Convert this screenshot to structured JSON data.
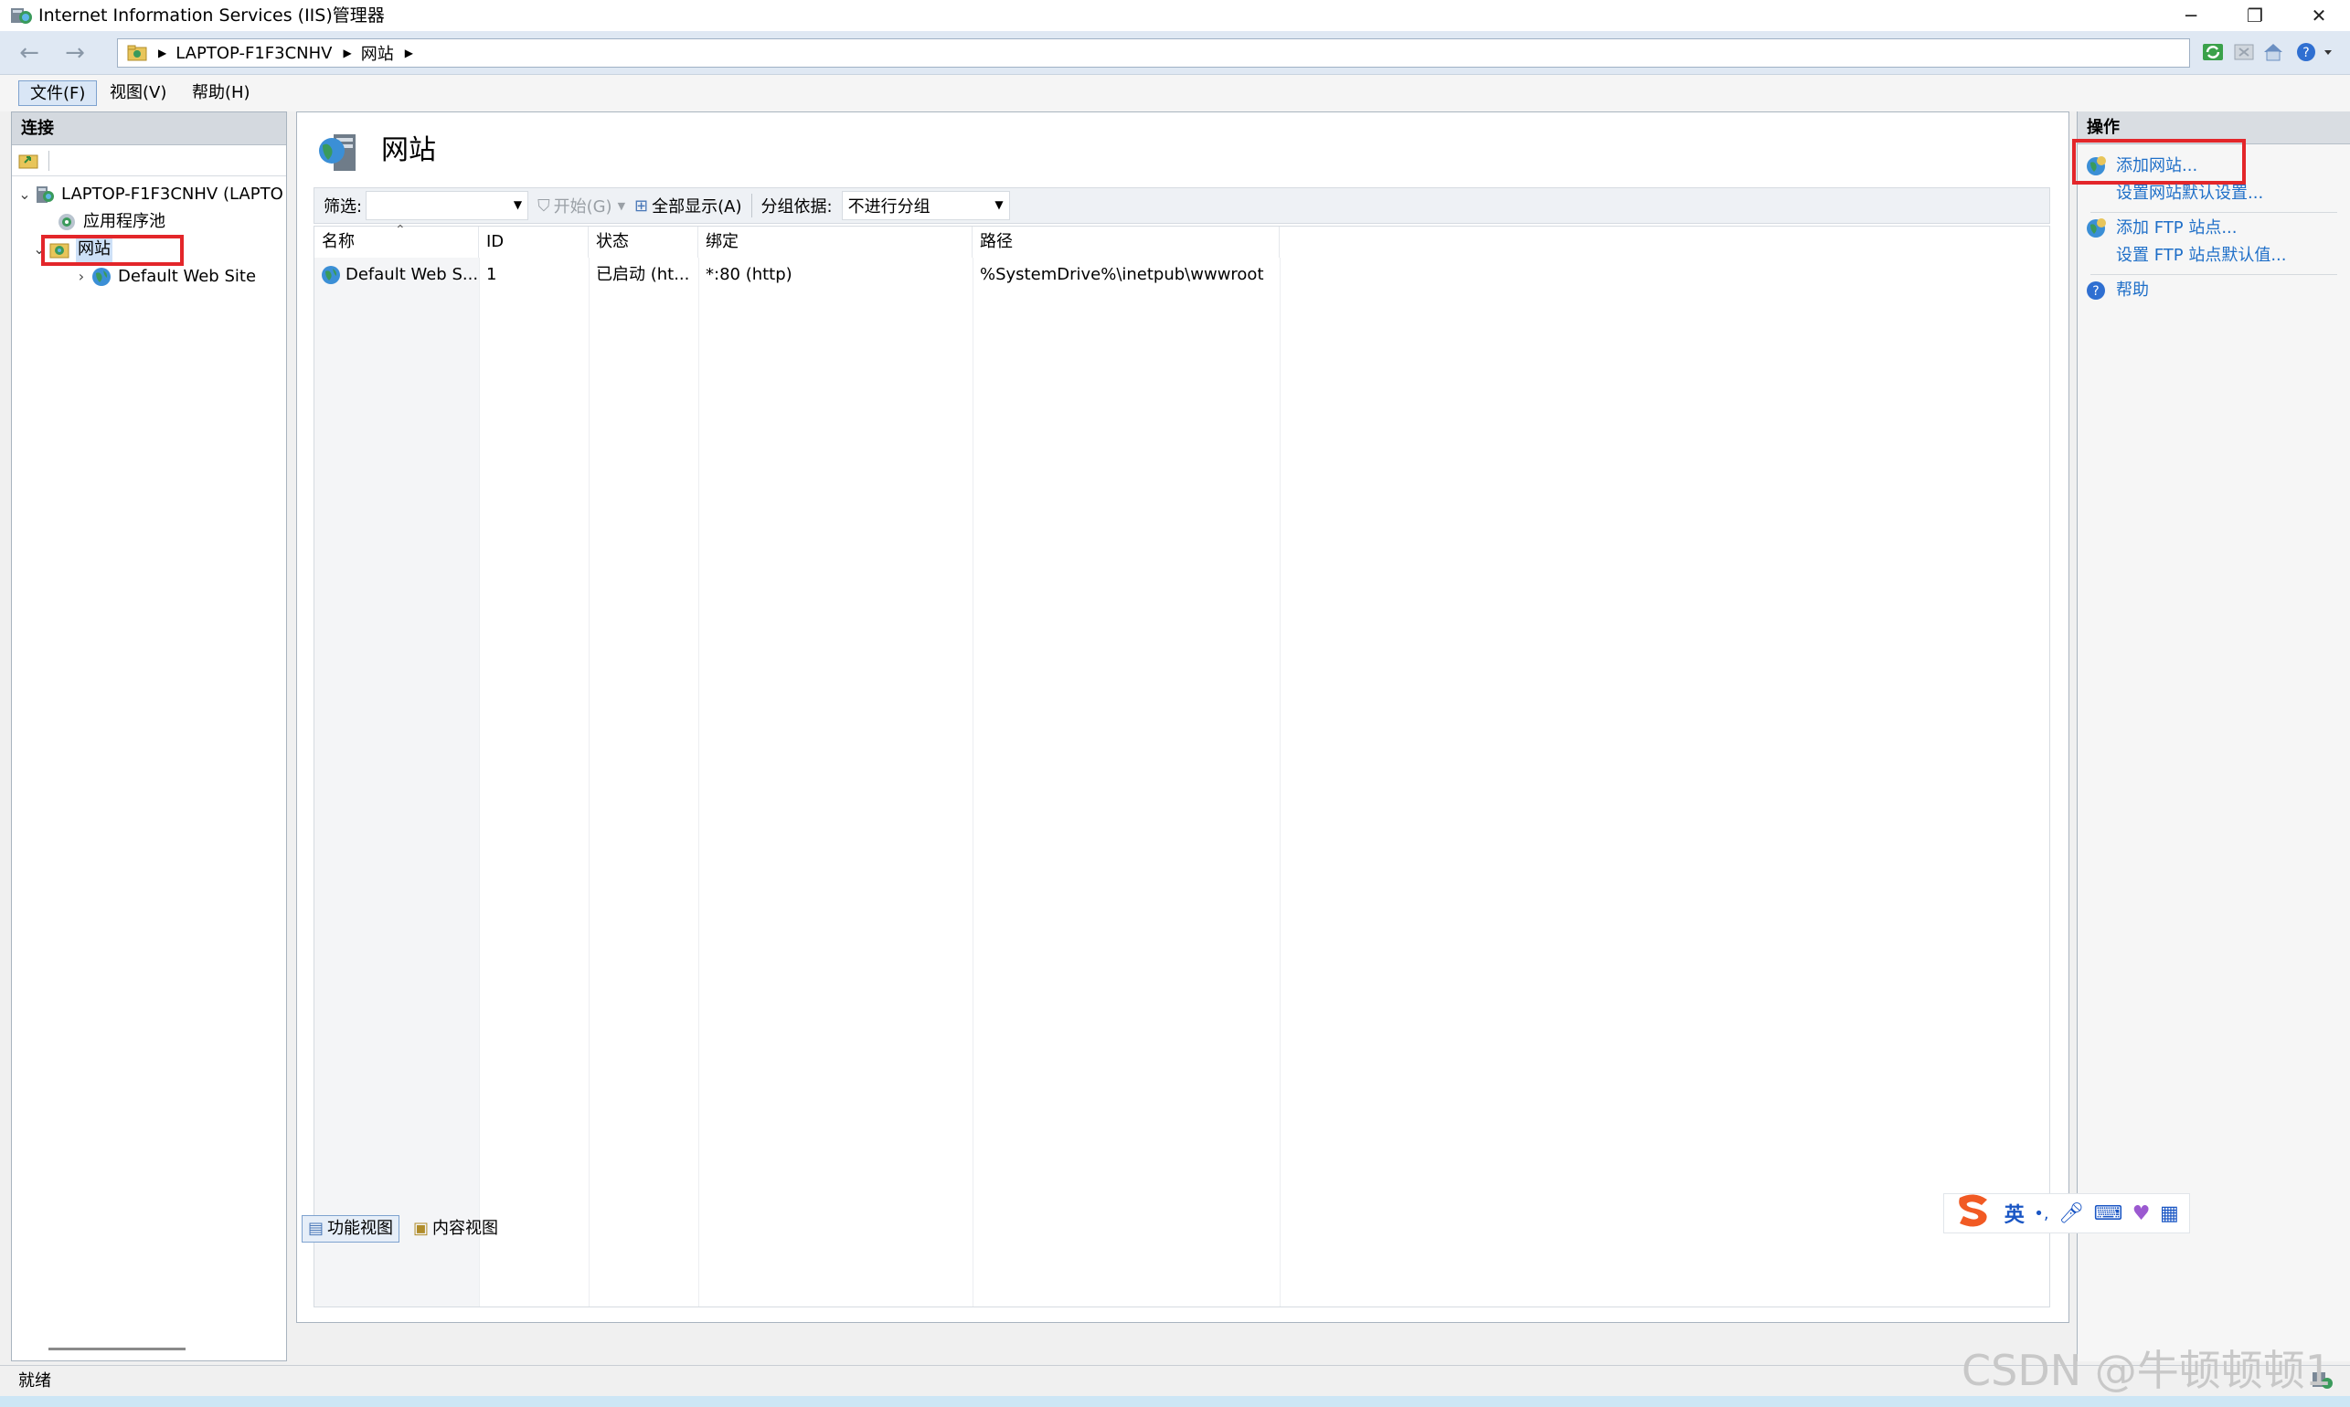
{
  "window": {
    "title": "Internet Information Services (IIS)管理器",
    "minimize_glyph": "─",
    "restore_glyph": "❐",
    "close_glyph": "✕"
  },
  "address": {
    "segments": [
      "LAPTOP-F1F3CNHV",
      "网站"
    ]
  },
  "menu": {
    "file": "文件(F)",
    "view": "视图(V)",
    "help": "帮助(H)"
  },
  "connections": {
    "header": "连接",
    "tree": {
      "server": "LAPTOP-F1F3CNHV (LAPTO",
      "app_pools": "应用程序池",
      "sites": "网站",
      "default_site": "Default Web Site"
    }
  },
  "main": {
    "title": "网站",
    "filter": {
      "label": "筛选:",
      "start_label": "开始(G)",
      "show_all_label": "全部显示(A)",
      "group_by_label": "分组依据:",
      "group_by_value": "不进行分组"
    },
    "table": {
      "columns": [
        "名称",
        "ID",
        "状态",
        "绑定",
        "路径"
      ],
      "rows": [
        {
          "name": "Default Web S...",
          "id": "1",
          "status": "已启动 (ht...",
          "binding": "*:80 (http)",
          "path": "%SystemDrive%\\inetpub\\wwwroot"
        }
      ]
    },
    "tabs": {
      "feature_view": "功能视图",
      "content_view": "内容视图"
    }
  },
  "actions": {
    "header": "操作",
    "add_site": "添加网站...",
    "site_defaults": "设置网站默认设置...",
    "add_ftp": "添加 FTP 站点...",
    "ftp_defaults": "设置 FTP 站点默认值...",
    "help": "帮助"
  },
  "status": {
    "text": "就绪"
  },
  "ime": {
    "lang": "英",
    "punct": "•,"
  },
  "watermark": "CSDN @牛顿顿顿1",
  "colors": {
    "highlight_red": "#e3262a",
    "link_blue": "#1f6fc8"
  }
}
